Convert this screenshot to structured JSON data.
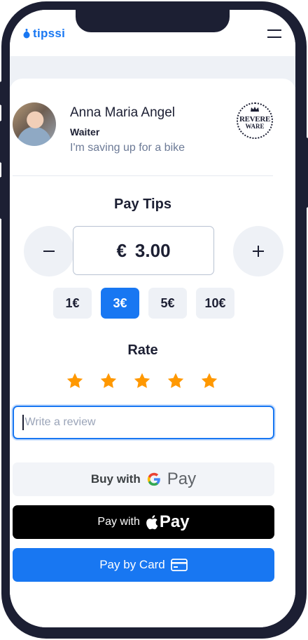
{
  "app": {
    "logo_text": "tipssi"
  },
  "profile": {
    "name": "Anna Maria Angel",
    "role": "Waiter",
    "bio": "I'm saving up for a bike",
    "brand_line1": "REVERE",
    "brand_line2": "WARE"
  },
  "tips": {
    "heading": "Pay Tips",
    "currency": "€",
    "amount": "3.00",
    "decrease_symbol": "−",
    "increase_symbol": "+",
    "presets": [
      "1€",
      "3€",
      "5€",
      "10€"
    ],
    "selected_preset": "3€"
  },
  "rate": {
    "heading": "Rate",
    "stars_filled": 5,
    "stars_total": 5,
    "star_color": "#ff9800"
  },
  "review": {
    "placeholder": "Write a review"
  },
  "payments": {
    "google_prefix": "Buy with",
    "google_brand": "Pay",
    "apple_prefix": "Pay with",
    "apple_brand": "Pay",
    "card_label": "Pay by Card"
  },
  "colors": {
    "accent": "#1877f2",
    "frame": "#1c1f33",
    "muted_text": "#6c7a96"
  }
}
